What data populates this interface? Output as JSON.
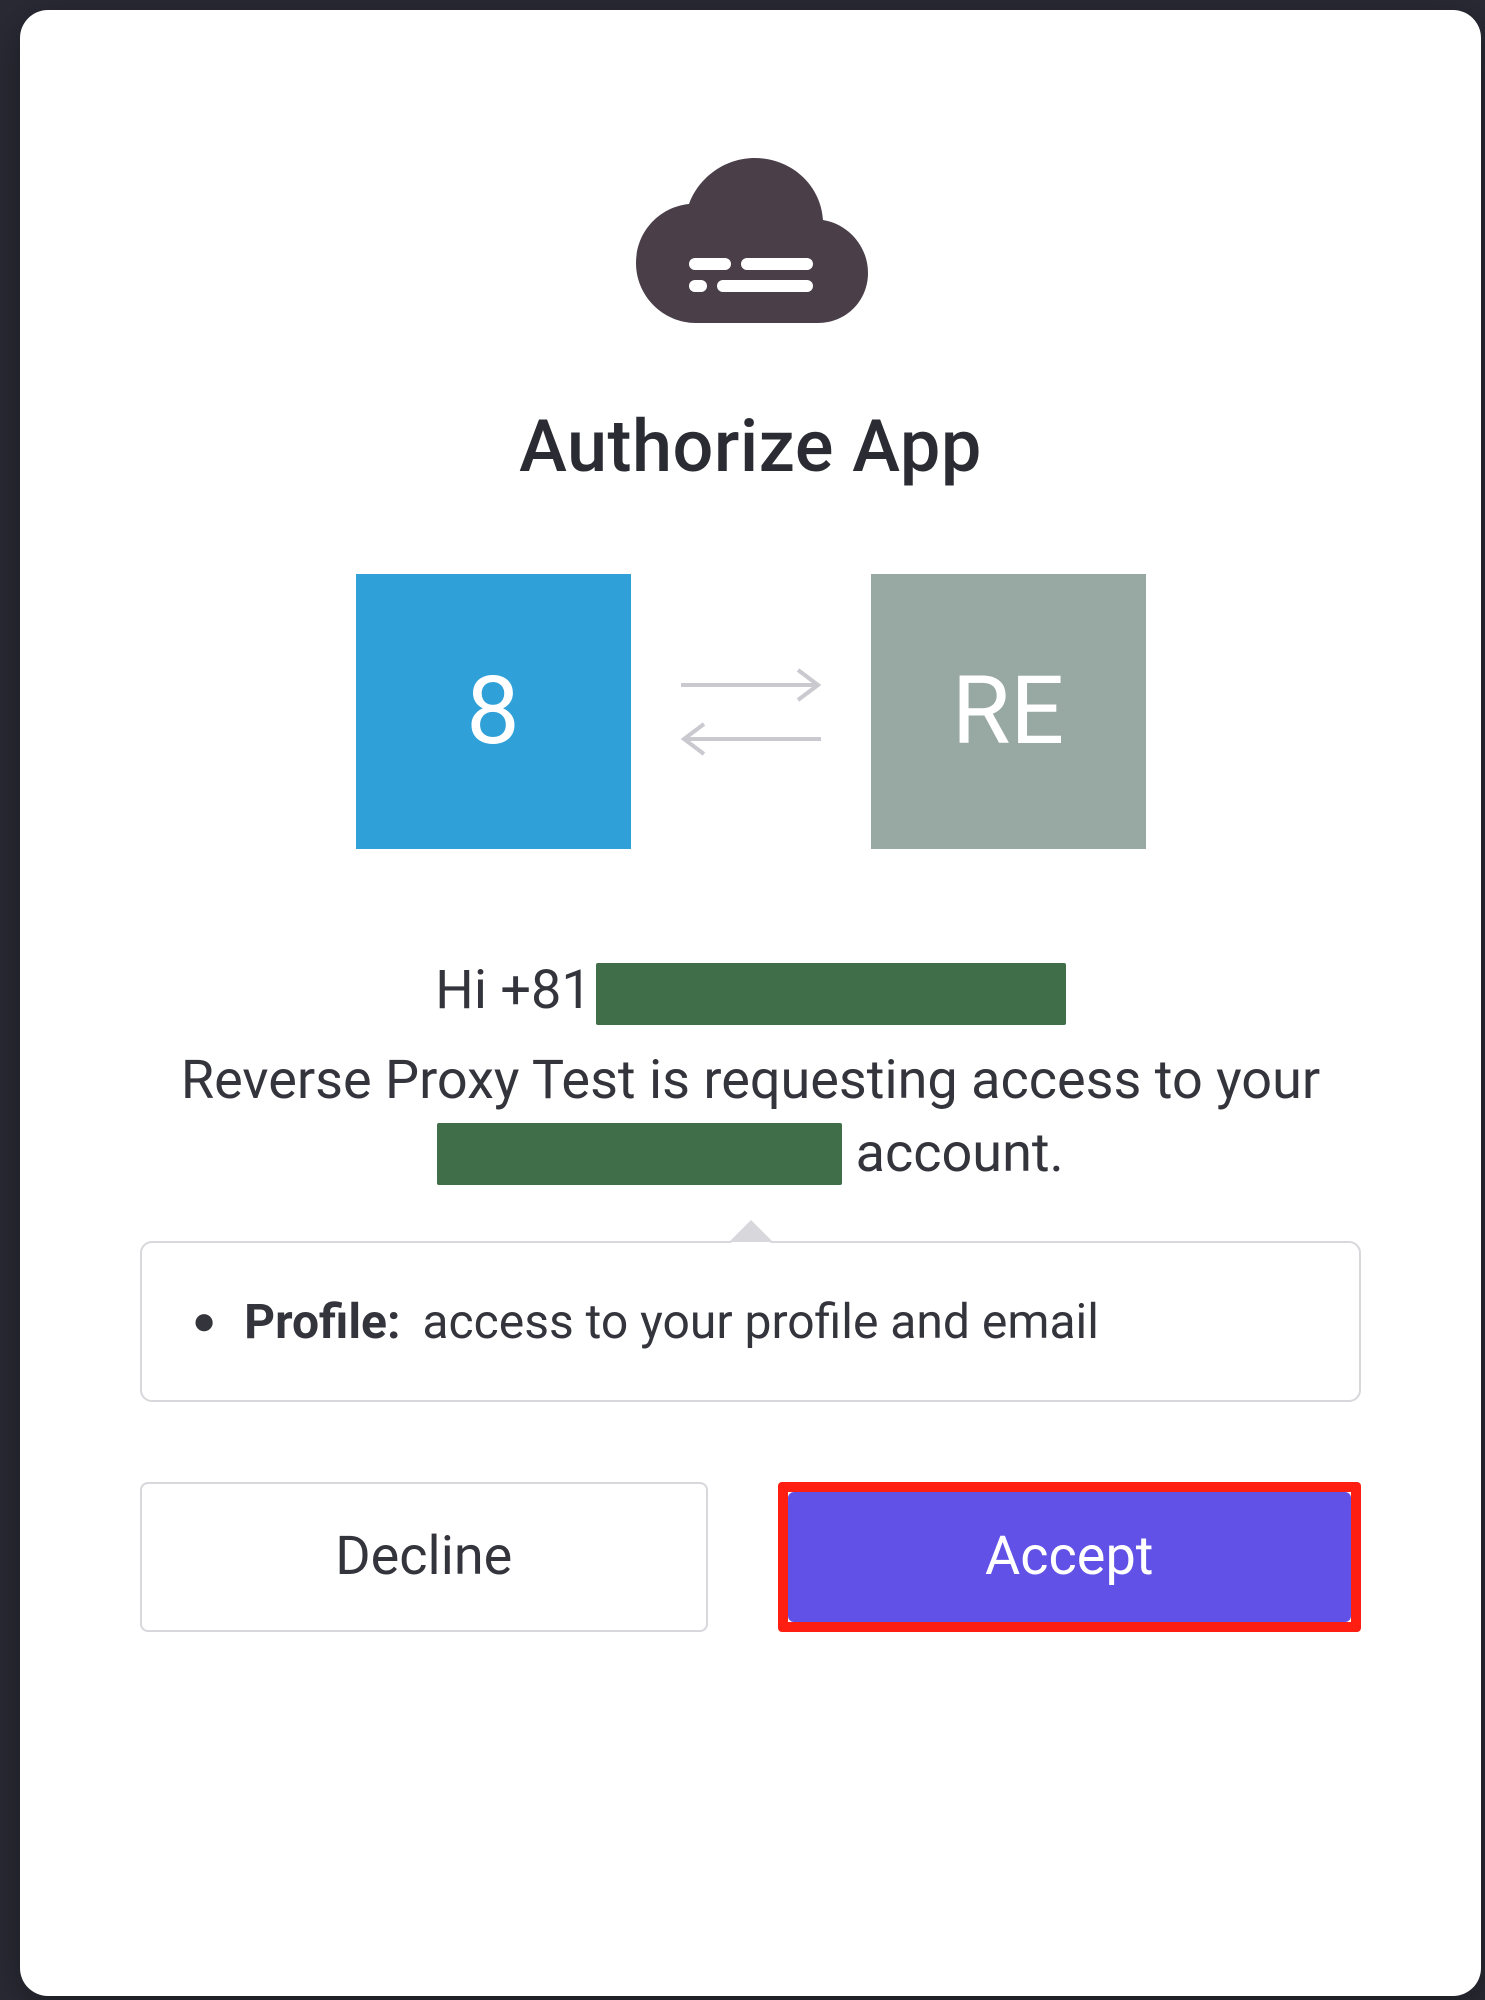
{
  "dialog": {
    "title": "Authorize App",
    "source_tile_label": "8",
    "target_tile_label": "RE",
    "greeting_prefix": "Hi +81",
    "app_name": "Reverse Proxy Test",
    "request_prefix": " is requesting access to your ",
    "request_suffix": " account.",
    "permissions": [
      {
        "label": "Profile:",
        "description": "access to your profile and email"
      }
    ],
    "decline_label": "Decline",
    "accept_label": "Accept"
  }
}
